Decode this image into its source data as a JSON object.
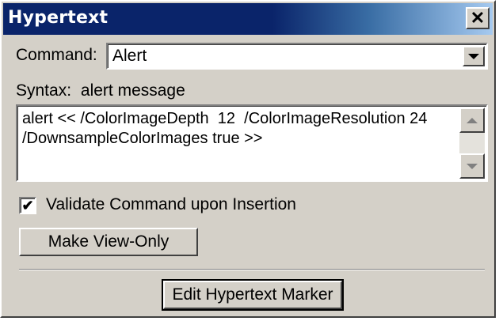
{
  "window": {
    "title": "Hypertext",
    "close_glyph": "✕"
  },
  "command": {
    "label": "Command:",
    "value": "Alert"
  },
  "syntax": {
    "label": "Syntax:",
    "value": "alert message"
  },
  "editor": {
    "text": "alert << /ColorImageDepth  12  /ColorImageResolution 24\n/DownsampleColorImages true >>"
  },
  "validate": {
    "label": "Validate Command upon Insertion",
    "checked": true,
    "check_glyph": "✔"
  },
  "buttons": {
    "make_view_only": "Make View-Only",
    "edit_marker": "Edit Hypertext Marker"
  },
  "colors": {
    "titlebar_start": "#0a246a",
    "titlebar_end": "#a6caf0",
    "face": "#d4d0c8"
  }
}
